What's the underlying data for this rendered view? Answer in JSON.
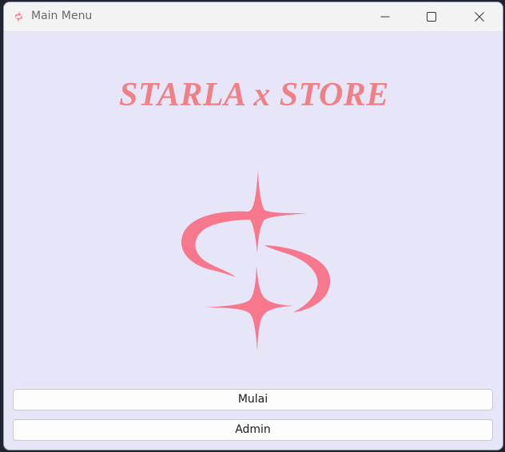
{
  "window": {
    "title": "Main Menu",
    "app_icon": "starla-s-icon",
    "controls": [
      "minimize-icon",
      "maximize-icon",
      "close-icon"
    ]
  },
  "main": {
    "heading": "STARLA x STORE",
    "logo_icon": "starla-sparkle-s-logo",
    "buttons": {
      "start_label": "Mulai",
      "admin_label": "Admin"
    }
  },
  "colors": {
    "accent": "#f07f86",
    "logo": "#f7778c",
    "background": "#e6e6f8",
    "titlebar": "#f3f3f3"
  }
}
